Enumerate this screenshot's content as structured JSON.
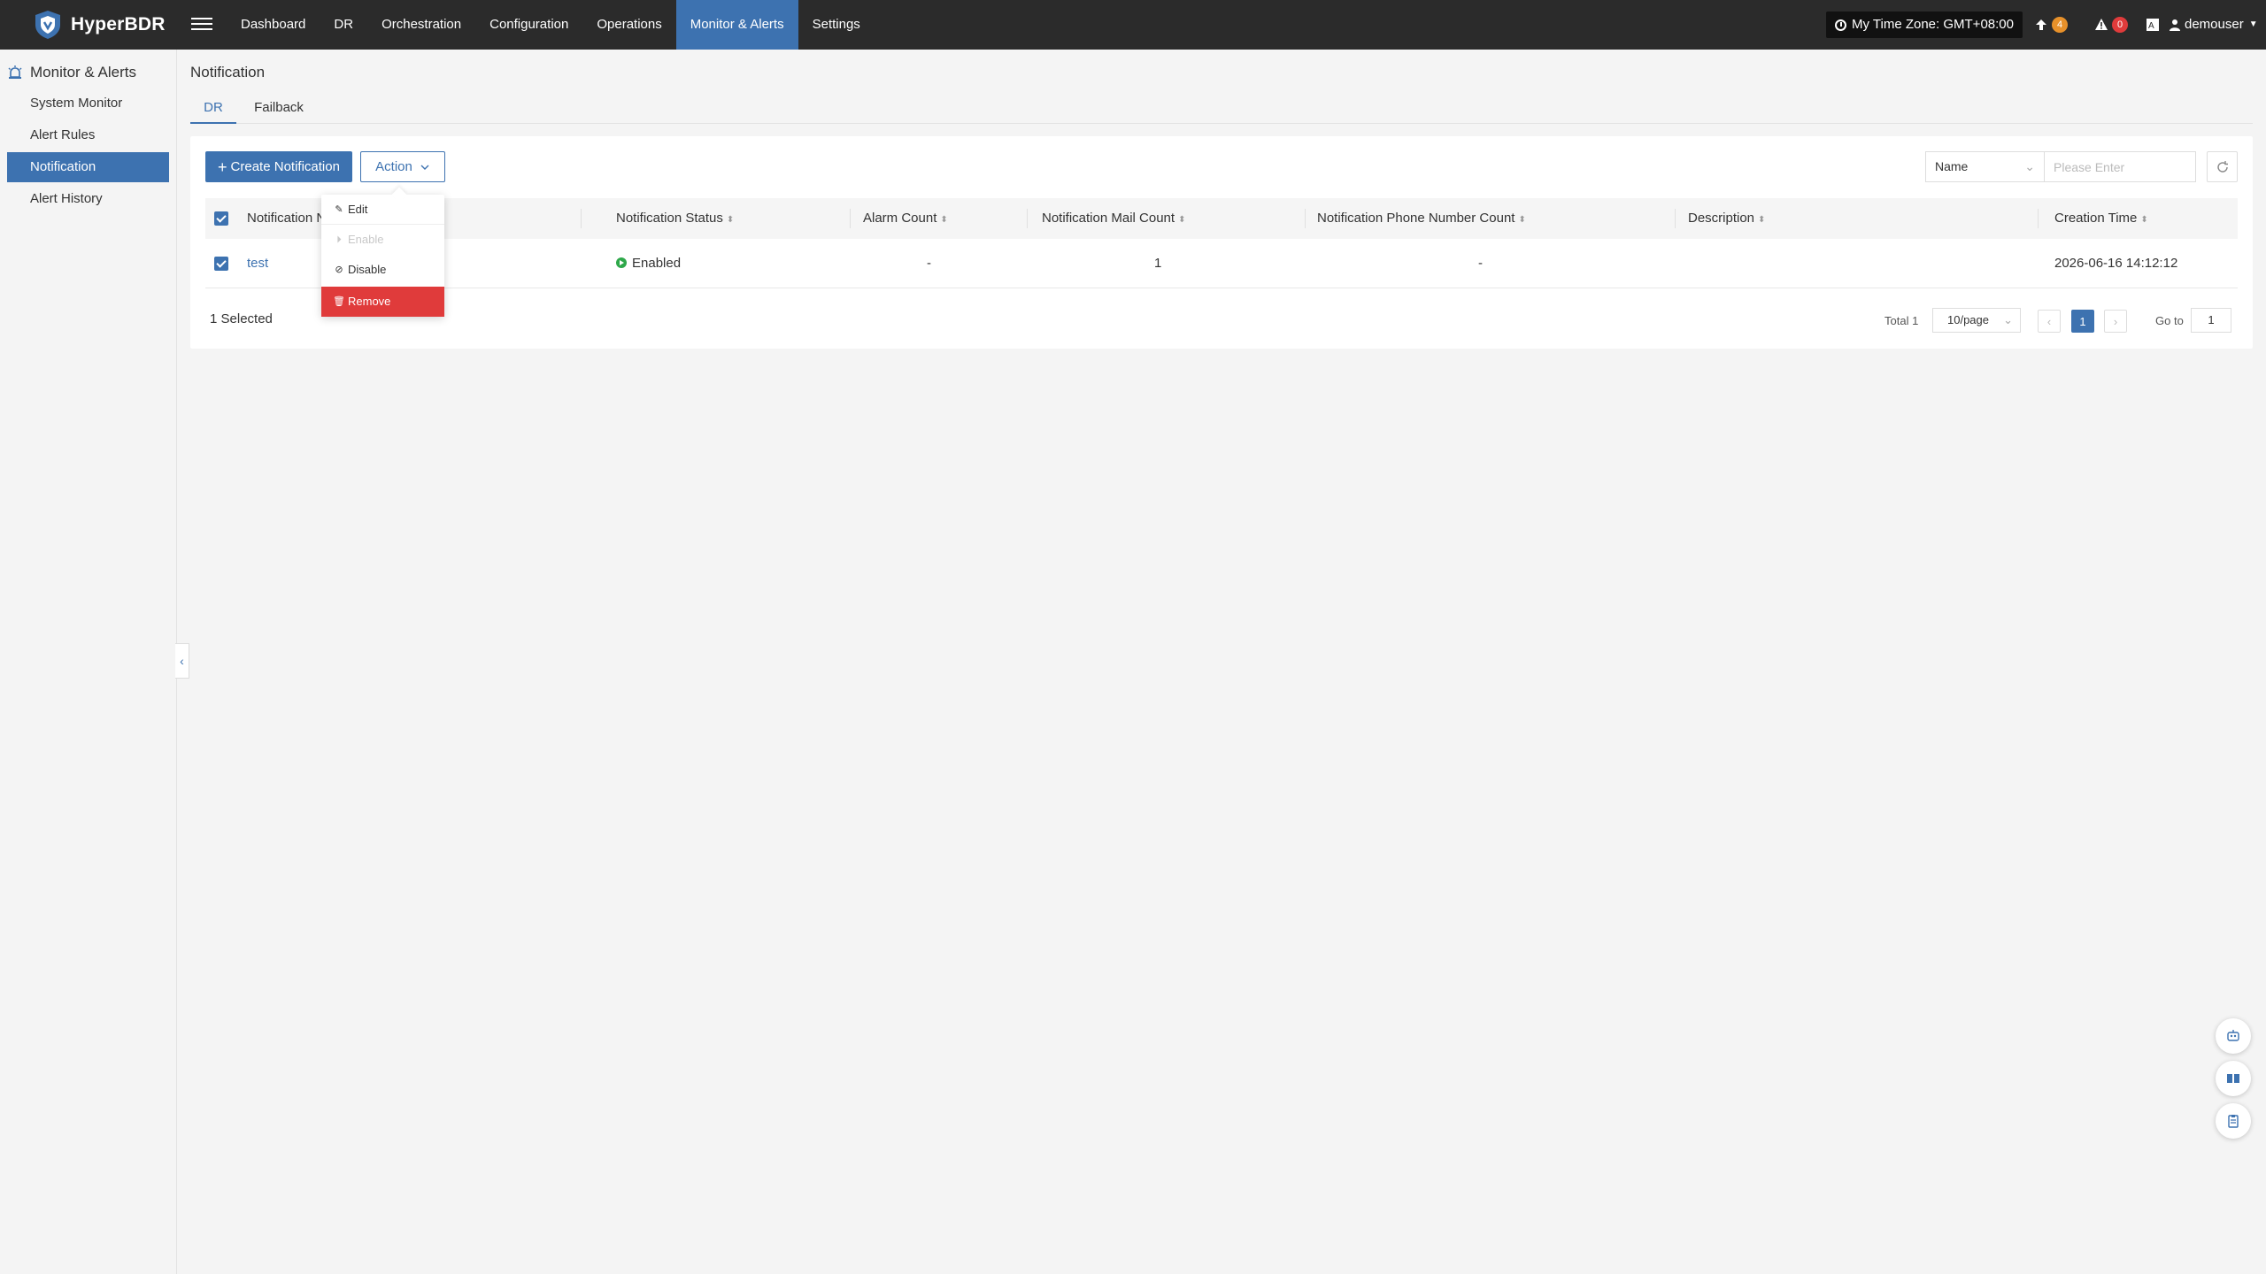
{
  "app": {
    "name": "HyperBDR"
  },
  "topnav": {
    "items": [
      "Dashboard",
      "DR",
      "Orchestration",
      "Configuration",
      "Operations",
      "Monitor & Alerts",
      "Settings"
    ],
    "active": "Monitor & Alerts"
  },
  "header": {
    "timezone": "My Time Zone: GMT+08:00",
    "upgrade_count": "4",
    "alert_count": "0",
    "user": "demouser"
  },
  "sidebar": {
    "title": "Monitor & Alerts",
    "items": [
      "System Monitor",
      "Alert Rules",
      "Notification",
      "Alert History"
    ],
    "active": "Notification"
  },
  "page": {
    "title": "Notification"
  },
  "tabs": [
    "DR",
    "Failback"
  ],
  "toolbar": {
    "create_label": "Create Notification",
    "action_label": "Action",
    "search_field": "Name",
    "search_placeholder": "Please Enter"
  },
  "action_menu": {
    "items": [
      {
        "label": "Edit",
        "state": "normal",
        "icon": "edit-icon"
      },
      {
        "label": "Enable",
        "state": "disabled",
        "icon": "play-icon"
      },
      {
        "label": "Disable",
        "state": "normal",
        "icon": "stop-icon"
      },
      {
        "label": "Remove",
        "state": "danger",
        "icon": "trash-icon"
      }
    ]
  },
  "table": {
    "columns": [
      "Notification Name",
      "Notification Status",
      "Alarm Count",
      "Notification Mail Count",
      "Notification Phone Number Count",
      "Description",
      "Creation Time"
    ],
    "header_name_visible": "Notification N",
    "rows": [
      {
        "name": "test",
        "status": "Enabled",
        "alarm_count": "-",
        "mail_count": "1",
        "phone_count": "-",
        "description": "",
        "created": "2026-06-16 14:12:12",
        "selected": true
      }
    ]
  },
  "footer": {
    "selected_text": "1 Selected",
    "total_text": "Total 1",
    "page_size": "10/page",
    "current_page": "1",
    "goto_label": "Go to",
    "goto_value": "1"
  },
  "colors": {
    "primary": "#3d72b0",
    "danger": "#e03b3b",
    "success": "#2ea84a",
    "topbar": "#2b2b2b"
  }
}
